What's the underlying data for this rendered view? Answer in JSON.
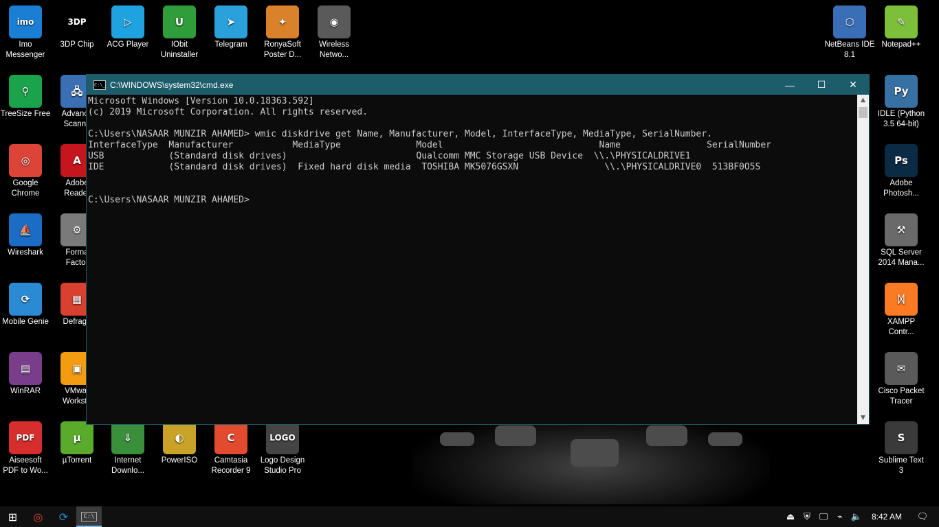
{
  "desktop": {
    "left_icons": [
      {
        "label": "Imo\nMessenger",
        "glyph": "imo",
        "color": "#1a7fd4"
      },
      {
        "label": "3DP Chip",
        "glyph": "3DP",
        "color": "#000000"
      },
      {
        "label": "ACG Player",
        "glyph": "▷",
        "color": "#1fa3e0"
      },
      {
        "label": "IObit\nUninstaller",
        "glyph": "U",
        "color": "#2f9e3a"
      },
      {
        "label": "Telegram",
        "glyph": "➤",
        "color": "#2aa1da"
      },
      {
        "label": "RonyaSoft\nPoster D...",
        "glyph": "✦",
        "color": "#d9822b"
      },
      {
        "label": "Wireless\nNetwo...",
        "glyph": "◉",
        "color": "#5a5a5a"
      },
      {
        "label": "TreeSize Free",
        "glyph": "⚲",
        "color": "#1aa34a"
      },
      {
        "label": "Advance\nScanne",
        "glyph": "🖧",
        "color": "#3b6fb3"
      },
      {
        "label": "Google\nChrome",
        "glyph": "◎",
        "color": "#db4437"
      },
      {
        "label": "Adobe\nReader",
        "glyph": "A",
        "color": "#c4161c"
      },
      {
        "label": "Wireshark",
        "glyph": "⛵",
        "color": "#1b6cc4"
      },
      {
        "label": "Forma\nFactor",
        "glyph": "⚙",
        "color": "#7a7a7a"
      },
      {
        "label": "Mobile Genie",
        "glyph": "⟳",
        "color": "#2b8ad4"
      },
      {
        "label": "Defragg",
        "glyph": "▦",
        "color": "#d94030"
      },
      {
        "label": "WinRAR",
        "glyph": "▤",
        "color": "#7a3d8c"
      },
      {
        "label": "VMwar\nWorksta",
        "glyph": "▣",
        "color": "#f39c12"
      },
      {
        "label": "Aiseesoft\nPDF to Wo...",
        "glyph": "PDF",
        "color": "#d62d2d"
      },
      {
        "label": "µTorrent",
        "glyph": "µ",
        "color": "#5aab2c"
      },
      {
        "label": "Internet\nDownlo...",
        "glyph": "⇓",
        "color": "#3a8f3a"
      },
      {
        "label": "PowerISO",
        "glyph": "◐",
        "color": "#c9a227"
      },
      {
        "label": "Camtasia\nRecorder 9",
        "glyph": "C",
        "color": "#e34b2f"
      },
      {
        "label": "Logo Design\nStudio Pro",
        "glyph": "LOGO",
        "color": "#444444"
      }
    ],
    "right_icons": [
      {
        "label": "NetBeans IDE\n8.1",
        "glyph": "⬡",
        "color": "#3a6fb8"
      },
      {
        "label": "Notepad++",
        "glyph": "✎",
        "color": "#7bbf3a"
      },
      {
        "label": "IDLE (Python\n3.5 64-bit)",
        "glyph": "Py",
        "color": "#3771a3"
      },
      {
        "label": "Adobe\nPhotosh...",
        "glyph": "Ps",
        "color": "#0b2b45"
      },
      {
        "label": "SQL Server\n2014 Mana...",
        "glyph": "⚒",
        "color": "#6a6a6a"
      },
      {
        "label": "XAMPP\nContr...",
        "glyph": "ᛞ",
        "color": "#fb7a24"
      },
      {
        "label": "Cisco Packet\nTracer",
        "glyph": "✉",
        "color": "#5a5a5a"
      },
      {
        "label": "Sublime Text\n3",
        "glyph": "S",
        "color": "#3a3a3a"
      }
    ],
    "partial_right_fragments": [
      "o",
      "."
    ]
  },
  "cmd_window": {
    "title": "C:\\WINDOWS\\system32\\cmd.exe",
    "icon_text": "C:\\_",
    "controls": {
      "minimize": "—",
      "maximize": "☐",
      "close": "✕"
    },
    "console_lines": [
      "Microsoft Windows [Version 10.0.18363.592]",
      "(c) 2019 Microsoft Corporation. All rights reserved.",
      "",
      "C:\\Users\\NASAAR MUNZIR AHAMED> wmic diskdrive get Name, Manufacturer, Model, InterfaceType, MediaType, SerialNumber.",
      "InterfaceType  Manufacturer           MediaType              Model                             Name                SerialNumber",
      "USB            (Standard disk drives)                        Qualcomm MMC Storage USB Device  \\\\.\\PHYSICALDRIVE1",
      "IDE            (Standard disk drives)  Fixed hard disk media  TOSHIBA MK5076GSXN                \\\\.\\PHYSICALDRIVE0  513BF0O5S",
      "",
      "",
      "C:\\Users\\NASAAR MUNZIR AHAMED>"
    ]
  },
  "taskbar": {
    "items": [
      {
        "name": "start-button",
        "glyph": "⊞",
        "color": "#ffffff"
      },
      {
        "name": "chrome-taskbar-icon",
        "glyph": "◎",
        "color": "#db4437"
      },
      {
        "name": "mobile-genie-taskbar-icon",
        "glyph": "⟳",
        "color": "#2b8ad4"
      },
      {
        "name": "cmd-taskbar-icon",
        "glyph": "C:\\",
        "color": "#cccccc"
      }
    ],
    "tray_icons": [
      {
        "name": "usb-icon",
        "glyph": "⏏"
      },
      {
        "name": "security-icon",
        "glyph": "⛨"
      },
      {
        "name": "network-icon",
        "glyph": "🖵"
      },
      {
        "name": "wifi-icon",
        "glyph": "⌁"
      },
      {
        "name": "volume-icon",
        "glyph": "🔈"
      }
    ],
    "clock": "8:42 AM",
    "notification_glyph": "🗨"
  }
}
